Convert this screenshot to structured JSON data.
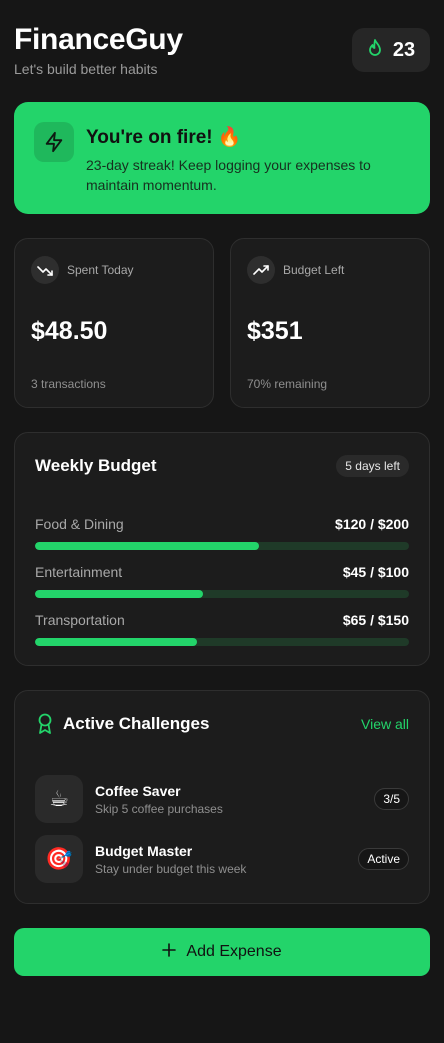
{
  "header": {
    "title": "FinanceGuy",
    "subtitle": "Let's build better habits",
    "streak_count": "23",
    "streak_icon": "flame-icon"
  },
  "banner": {
    "title": "You're on fire! 🔥",
    "text": "23-day streak! Keep logging your expenses to maintain momentum.",
    "icon": "lightning-icon",
    "color": "#23d46a"
  },
  "stats": [
    {
      "label": "Spent Today",
      "value": "$48.50",
      "sub": "3 transactions",
      "icon": "trending-down-icon"
    },
    {
      "label": "Budget Left",
      "value": "$351",
      "sub": "70% remaining",
      "icon": "trending-up-icon"
    }
  ],
  "budget": {
    "title": "Weekly Budget",
    "days_left": "5 days left",
    "rows": [
      {
        "name": "Food & Dining",
        "amount": "$120 / $200",
        "progress": 0.6
      },
      {
        "name": "Entertainment",
        "amount": "$45 / $100",
        "progress": 0.45
      },
      {
        "name": "Transportation",
        "amount": "$65 / $150",
        "progress": 0.433
      }
    ]
  },
  "challenges": {
    "title": "Active Challenges",
    "view_all": "View all",
    "items": [
      {
        "emoji": "☕",
        "name": "Coffee Saver",
        "desc": "Skip 5 coffee purchases",
        "badge": "3/5"
      },
      {
        "emoji": "🎯",
        "name": "Budget Master",
        "desc": "Stay under budget this week",
        "badge": "Active"
      }
    ]
  },
  "actions": {
    "add_expense": "Add Expense"
  },
  "colors": {
    "accent": "#23d46a",
    "background": "#161616",
    "card": "#1c1c1c"
  }
}
